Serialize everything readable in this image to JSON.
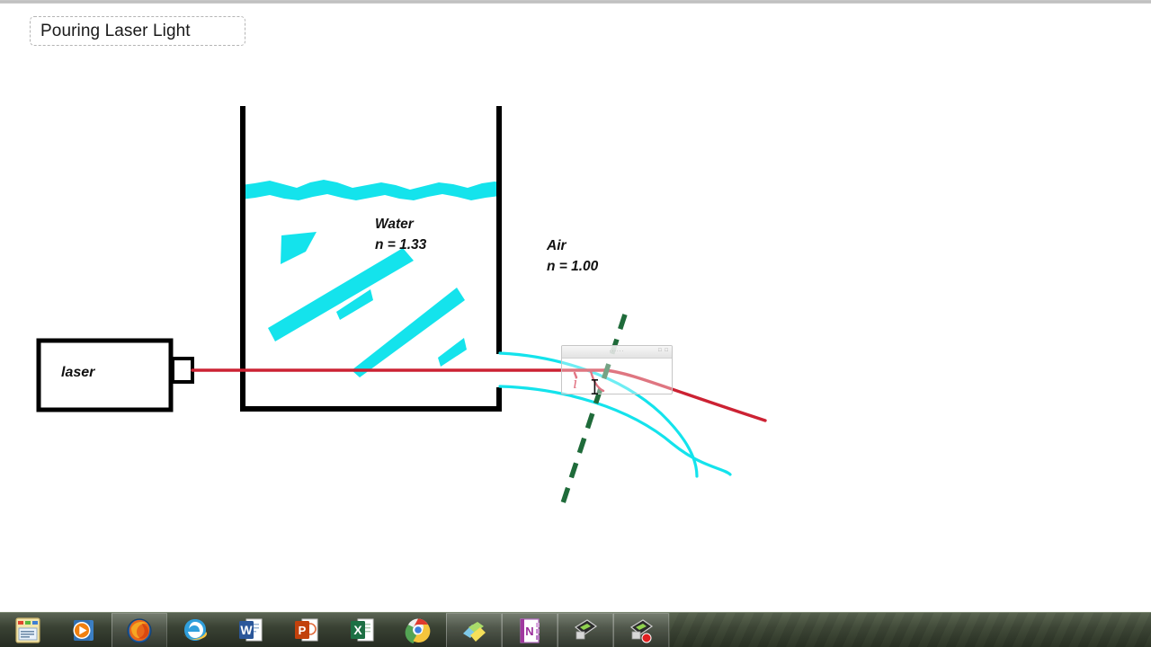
{
  "window": {
    "title": "Pouring Laser Light"
  },
  "diagram": {
    "title": "Pouring Laser Light",
    "laser_label": "laser",
    "water_label": "Water",
    "water_index": "n = 1.33",
    "air_label": "Air",
    "air_index": "n = 1.00",
    "angle_label": "i",
    "colors": {
      "water": "#14e3ec",
      "laser_beam": "#cc2233",
      "normal_line": "#1f6b3a",
      "container": "#000000",
      "annotation": "#d2203a"
    }
  },
  "ghost_window": {
    "title": "......",
    "controls": "□ □"
  },
  "taskbar": {
    "items": [
      {
        "name": "sticky-notes",
        "label": "Sticky Notes",
        "active": false
      },
      {
        "name": "media-player",
        "label": "Windows Media Player",
        "active": false
      },
      {
        "name": "firefox",
        "label": "Mozilla Firefox",
        "active": true
      },
      {
        "name": "internet-explorer",
        "label": "Internet Explorer",
        "active": false
      },
      {
        "name": "word",
        "label": "Microsoft Word",
        "active": false
      },
      {
        "name": "powerpoint",
        "label": "Microsoft PowerPoint",
        "active": false
      },
      {
        "name": "excel",
        "label": "Microsoft Excel",
        "active": false
      },
      {
        "name": "chrome",
        "label": "Google Chrome",
        "active": false
      },
      {
        "name": "sticky-notes-stack",
        "label": "Notes",
        "active": true
      },
      {
        "name": "onenote",
        "label": "Microsoft OneNote",
        "active": true
      },
      {
        "name": "screen-capture",
        "label": "Screen Capture",
        "active": true
      },
      {
        "name": "screen-recorder",
        "label": "Screen Recorder",
        "active": true
      }
    ]
  }
}
